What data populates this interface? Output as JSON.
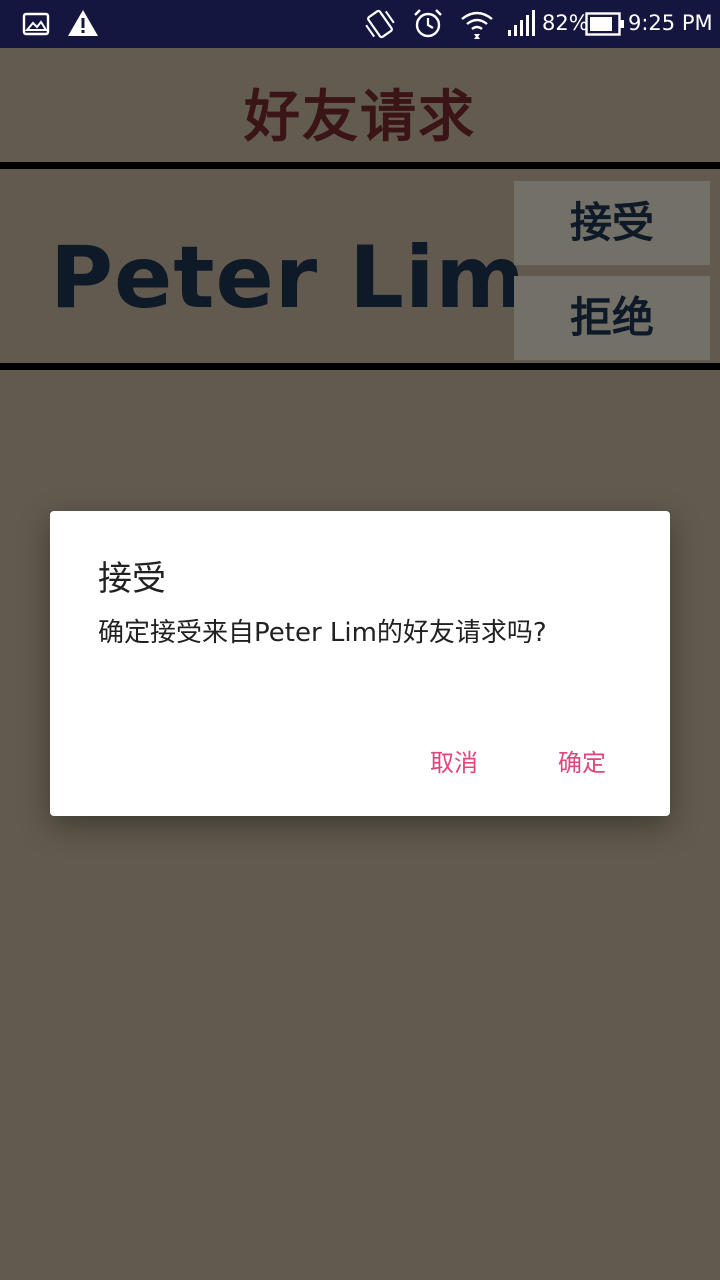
{
  "status_bar": {
    "battery_percent": "82%",
    "time": "9:25 PM",
    "icons": [
      "image-icon",
      "warning-icon",
      "vibrate-icon",
      "alarm-icon",
      "wifi-icon",
      "signal-icon",
      "battery-icon"
    ]
  },
  "header": {
    "title": "好友请求"
  },
  "request": {
    "name": "Peter Lim",
    "accept_label": "接受",
    "reject_label": "拒绝"
  },
  "dialog": {
    "title": "接受",
    "message": "确定接受来自Peter Lim的好友请求吗?",
    "cancel_label": "取消",
    "confirm_label": "确定"
  },
  "colors": {
    "status_bar": "#14163f",
    "background": "#615a4e",
    "title_text": "#3a1416",
    "name_text": "#0e1a28",
    "dialog_button": "#e0457b"
  }
}
